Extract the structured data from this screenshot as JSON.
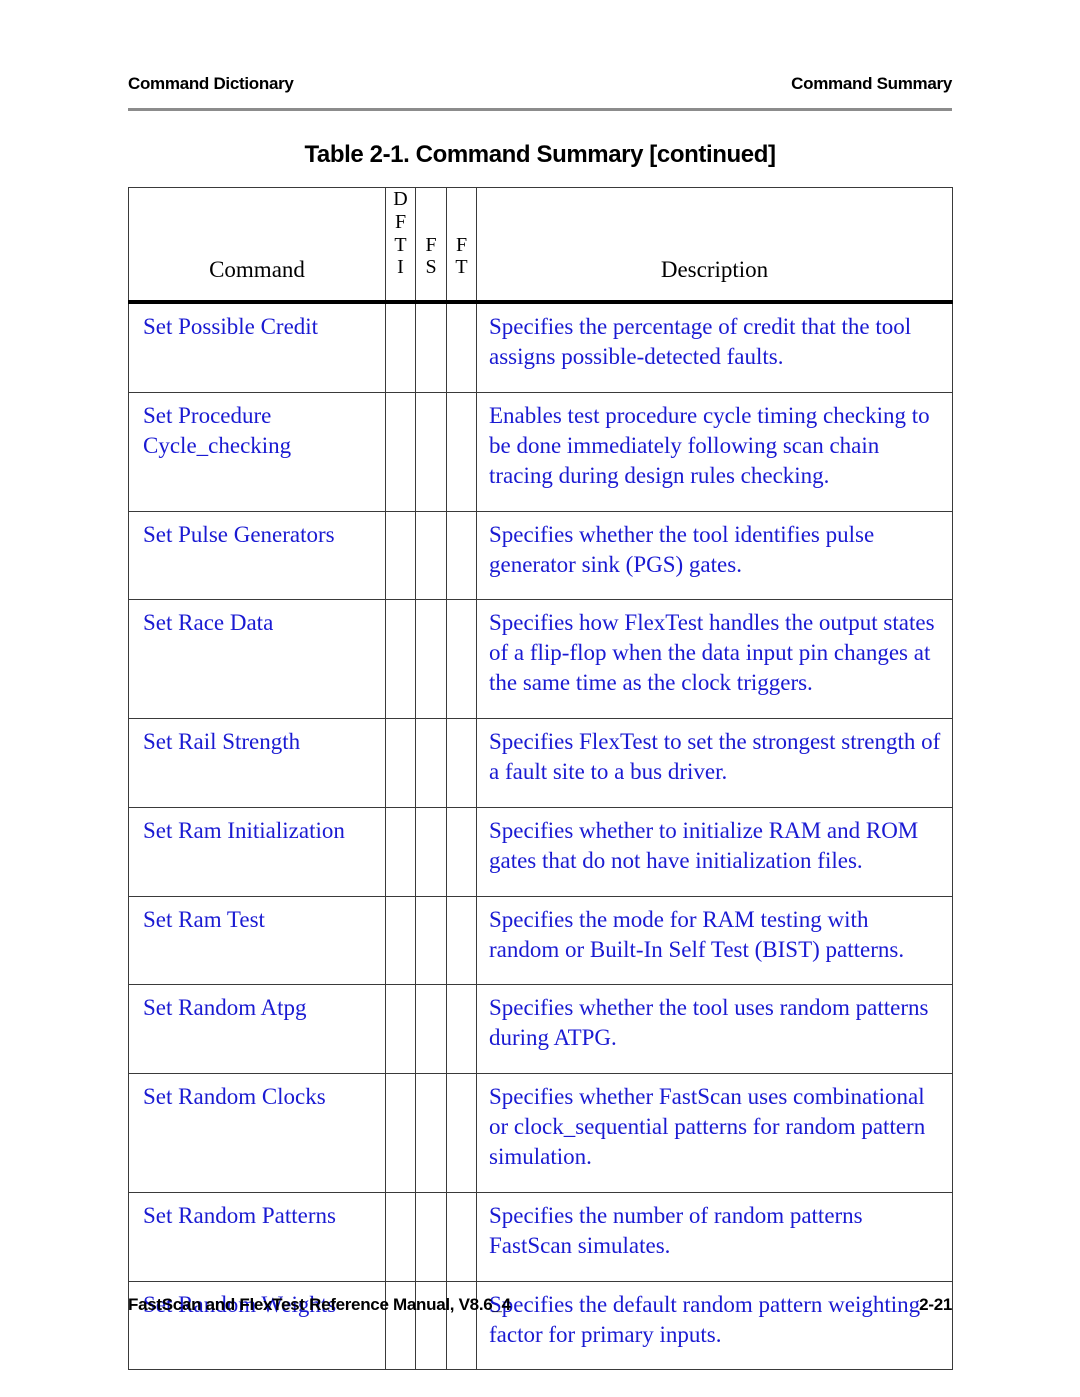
{
  "running_head": {
    "left": "Command Dictionary",
    "right": "Command Summary"
  },
  "table_caption": "Table 2-1. Command Summary [continued]",
  "table": {
    "headers": {
      "command": "Command",
      "dfti": "DFTI",
      "fs": "FS",
      "ft": "FT",
      "description": "Description"
    },
    "rows": [
      {
        "command": "Set Possible Credit",
        "dfti": "",
        "fs": "",
        "ft": "",
        "description": "Specifies the percentage of credit that the tool assigns possible-detected faults."
      },
      {
        "command": "Set Procedure Cycle_checking",
        "dfti": "",
        "fs": "",
        "ft": "",
        "description": "Enables test procedure cycle timing checking to be done immediately following scan chain tracing during design rules checking."
      },
      {
        "command": "Set Pulse Generators",
        "dfti": "",
        "fs": "",
        "ft": "",
        "description": "Specifies whether the tool identifies pulse generator sink (PGS) gates."
      },
      {
        "command": "Set Race Data",
        "dfti": "",
        "fs": "",
        "ft": "",
        "description": "Specifies how FlexTest handles the output states of a flip-flop when the data input pin changes at the same time as the clock triggers."
      },
      {
        "command": "Set Rail Strength",
        "dfti": "",
        "fs": "",
        "ft": "",
        "description": "Specifies FlexTest to set the strongest strength of a fault site to a bus driver."
      },
      {
        "command": "Set Ram Initialization",
        "dfti": "",
        "fs": "",
        "ft": "",
        "description": "Specifies whether to initialize RAM and ROM gates that do not have initialization files."
      },
      {
        "command": "Set Ram Test",
        "dfti": "",
        "fs": "",
        "ft": "",
        "description": "Specifies the mode for RAM testing with random or Built-In Self Test (BIST) patterns."
      },
      {
        "command": "Set Random Atpg",
        "dfti": "",
        "fs": "",
        "ft": "",
        "description": "Specifies whether the tool uses random patterns during ATPG."
      },
      {
        "command": "Set Random Clocks",
        "dfti": "",
        "fs": "",
        "ft": "",
        "description": "Specifies whether FastScan uses combinational or clock_sequential patterns for random pattern simulation."
      },
      {
        "command": "Set Random Patterns",
        "dfti": "",
        "fs": "",
        "ft": "",
        "description": "Specifies the number of random patterns FastScan simulates."
      },
      {
        "command": "Set Random Weights",
        "dfti": "",
        "fs": "",
        "ft": "",
        "description": "Specifies the default random pattern weighting factor for primary inputs."
      }
    ]
  },
  "footer": {
    "left": "FastScan and FlexTest Reference Manual, V8.6_4",
    "right": "2-21"
  },
  "colors": {
    "body_text_blue": "#1a1ad2",
    "heading_black": "#000000",
    "rule_grey": "#8c8c8c",
    "table_border": "#3a3a3a"
  }
}
